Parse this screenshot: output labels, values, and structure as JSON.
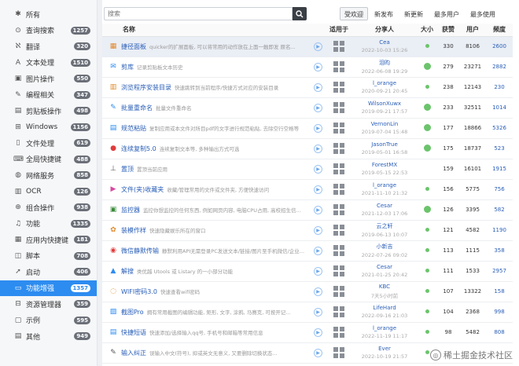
{
  "sidebar": {
    "items": [
      {
        "icon": "✱",
        "label": "所有",
        "count": ""
      },
      {
        "icon": "⊙",
        "label": "查询搜索",
        "count": "1257"
      },
      {
        "icon": "ℵ",
        "label": "翻译",
        "count": "320"
      },
      {
        "icon": "A",
        "label": "文本处理",
        "count": "1510"
      },
      {
        "icon": "▣",
        "label": "图片操作",
        "count": "550"
      },
      {
        "icon": "✎",
        "label": "编程相关",
        "count": "347"
      },
      {
        "icon": "▤",
        "label": "剪贴板操作",
        "count": "498"
      },
      {
        "icon": "⊞",
        "label": "Windows",
        "count": "1156"
      },
      {
        "icon": "▯",
        "label": "文件处理",
        "count": "619"
      },
      {
        "icon": "⌨",
        "label": "全局快捷键",
        "count": "488"
      },
      {
        "icon": "◍",
        "label": "网络服务",
        "count": "858"
      },
      {
        "icon": "▥",
        "label": "OCR",
        "count": "126"
      },
      {
        "icon": "⊕",
        "label": "组合操作",
        "count": "938"
      },
      {
        "icon": "♫",
        "label": "功能",
        "count": "1335"
      },
      {
        "icon": "▦",
        "label": "应用内快捷键",
        "count": "181"
      },
      {
        "icon": "◫",
        "label": "脚本",
        "count": "708"
      },
      {
        "icon": "➚",
        "label": "启动",
        "count": "406"
      },
      {
        "icon": "▭",
        "label": "功能增强",
        "count": "1357"
      },
      {
        "icon": "⊟",
        "label": "资源管理器",
        "count": "359"
      },
      {
        "icon": "▢",
        "label": "示例",
        "count": "595"
      },
      {
        "icon": "▤",
        "label": "其他",
        "count": "949"
      }
    ],
    "active_index": 17
  },
  "search": {
    "placeholder": "搜索"
  },
  "tabs": [
    {
      "label": "受欢迎",
      "active": true
    },
    {
      "label": "新发布"
    },
    {
      "label": "新更新"
    },
    {
      "label": "最多用户"
    },
    {
      "label": "最多使用"
    }
  ],
  "columns": {
    "name": "名称",
    "for": "适用于",
    "sharer": "分享人",
    "size": "大小",
    "likes": "获赞",
    "users": "用户",
    "freq": "频度"
  },
  "rows": [
    {
      "icon": "▦",
      "color": "#e08a2c",
      "title": "捷径面板",
      "desc": "quicker的扩展面板, 可以将常用的动作放在上面一触即发 原名...",
      "user": "Cea",
      "time": "2022-10-03 15:26",
      "size": "s",
      "likes": "330",
      "users": "8106",
      "freq": "2600"
    },
    {
      "icon": "✉",
      "color": "#2d8cf0",
      "title": "剪库",
      "desc": "记录剪贴板文本历史",
      "user": "泪昀",
      "time": "2022-06-08 19:29",
      "size": "l",
      "likes": "279",
      "users": "23271",
      "freq": "2882"
    },
    {
      "icon": "▥",
      "color": "#e08a2c",
      "title": "浏览程序安装目录",
      "desc": "快速跳转到当前程序/快捷方式对应的安装目录",
      "user": "l_orange",
      "time": "2020-09-21 20:45",
      "size": "s",
      "likes": "238",
      "users": "12143",
      "freq": "230"
    },
    {
      "icon": "✎",
      "color": "#2d8cf0",
      "title": "批量重命名",
      "desc": "批量文件重命名",
      "user": "WilsonXuwx",
      "time": "2019-09-21 17:57",
      "size": "l",
      "likes": "233",
      "users": "32511",
      "freq": "1014"
    },
    {
      "icon": "▤",
      "color": "#2d8cf0",
      "title": "规范粘贴",
      "desc": "复制应用或本文件对所目pdf的文字进行规范粘贴, 去除空行空格等",
      "user": "VernonLin",
      "time": "2019-07-04 15:48",
      "size": "l",
      "likes": "177",
      "users": "18866",
      "freq": "5326"
    },
    {
      "icon": "●",
      "color": "#e03c3c",
      "title": "连续复制5.0",
      "desc": "连续复制文本等, 多种输出方式可选",
      "user": "JasonTrue",
      "time": "2019-05-01 16:58",
      "size": "l",
      "likes": "175",
      "users": "18737",
      "freq": "523"
    },
    {
      "icon": "⊥",
      "color": "#555",
      "title": "置顶",
      "desc": "置顶当前应用",
      "user": "ForestMX",
      "time": "2019-05-15 22:53",
      "size": "",
      "likes": "159",
      "users": "16101",
      "freq": "1915"
    },
    {
      "icon": "▶",
      "color": "#d84aa3",
      "title": "文件(夹)收藏夹",
      "desc": "收藏/管理常用的文件或文件夹, 方便快速访问",
      "user": "l_orange",
      "time": "2021-11-10 21:32",
      "size": "s",
      "likes": "156",
      "users": "5775",
      "freq": "756"
    },
    {
      "icon": "▣",
      "color": "#3a8a3a",
      "title": "监控器",
      "desc": "监控你想监控的任何东西, 例如网页内容, 电脑CPU占用, 高校招生信...",
      "user": "Cesar",
      "time": "2021-12-03 17:06",
      "size": "l",
      "likes": "126",
      "users": "3395",
      "freq": "582"
    },
    {
      "icon": "✿",
      "color": "#e08a2c",
      "title": "装模作样",
      "desc": "快速隐藏娱乐所在的窗口",
      "user": "云之轩",
      "time": "2019-06-13 10:07",
      "size": "s",
      "likes": "121",
      "users": "4582",
      "freq": "1190"
    },
    {
      "icon": "◉",
      "color": "#e03c3c",
      "title": "微信静默传输",
      "desc": "静默利用API无需登录PC发送文本/链接/图片至手机微信/企业...",
      "user": "小新吉",
      "time": "2022-07-26 09:02",
      "size": "s",
      "likes": "113",
      "users": "1115",
      "freq": "358"
    },
    {
      "icon": "▲",
      "color": "#2d8cf0",
      "title": "解搜",
      "desc": "类优越 Utools 或 Listary 的一小部分功能",
      "user": "Cesar",
      "time": "2021-01-25 20:42",
      "size": "s",
      "likes": "111",
      "users": "1533",
      "freq": "2957"
    },
    {
      "icon": "◌",
      "color": "#e08a2c",
      "title": "WIFI密码3.0",
      "desc": "快速查看wifi密码",
      "user": "KBC",
      "time": "7天5小时前",
      "size": "s",
      "likes": "107",
      "users": "13322",
      "freq": "158"
    },
    {
      "icon": "▨",
      "color": "#2d8cf0",
      "title": "截图Pro",
      "desc": "拥有常用截图的编辑功能, 矩形, 文字, 涂鸦, 马赛克, 可按开记...",
      "user": "LifeHard",
      "time": "2022-09-16 21:03",
      "size": "s",
      "likes": "104",
      "users": "2368",
      "freq": "998"
    },
    {
      "icon": "▤",
      "color": "#2d8cf0",
      "title": "快捷短语",
      "desc": "快速添加/选择输入qq号, 手机号和邮箱等常用信息",
      "user": "l_orange",
      "time": "2022-11-19 11:17",
      "size": "s",
      "likes": "98",
      "users": "5482",
      "freq": "808"
    },
    {
      "icon": "✎",
      "color": "#555",
      "title": "输入纠正",
      "desc": "误输入中文(符号), 抑或英文无意义, 又要删除切换状态...",
      "user": "Ever",
      "time": "2022-10-19 21:57",
      "size": "s",
      "likes": "",
      "users": "",
      "freq": ""
    }
  ],
  "watermark": "稀土掘金技术社区"
}
